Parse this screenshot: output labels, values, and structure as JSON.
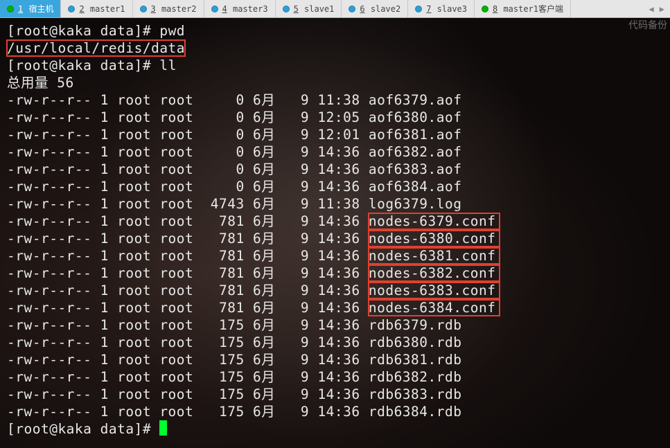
{
  "tabs": [
    {
      "dot": "green",
      "num": "1",
      "label": "宿主机",
      "active": true
    },
    {
      "dot": "blue",
      "num": "2",
      "label": "master1"
    },
    {
      "dot": "blue",
      "num": "3",
      "label": "master2"
    },
    {
      "dot": "blue",
      "num": "4",
      "label": "master3"
    },
    {
      "dot": "blue",
      "num": "5",
      "label": "slave1"
    },
    {
      "dot": "blue",
      "num": "6",
      "label": "slave2"
    },
    {
      "dot": "blue",
      "num": "7",
      "label": "slave3"
    },
    {
      "dot": "green",
      "num": "8",
      "label": "master1客户端"
    }
  ],
  "watermark": "代码备份",
  "prompt": {
    "user": "root",
    "host": "kaka",
    "cwd": "data",
    "symbol": "#"
  },
  "cmds": {
    "pwd": "pwd",
    "ll": "ll"
  },
  "cwd_path": "/usr/local/redis/data",
  "total_label": "总用量",
  "total_value": "56",
  "ls": [
    {
      "perm": "-rw-r--r--",
      "l": "1",
      "u": "root",
      "g": "root",
      "size": "0",
      "mon": "6月",
      "day": "9",
      "time": "11:38",
      "name": "aof6379.aof",
      "hl": false
    },
    {
      "perm": "-rw-r--r--",
      "l": "1",
      "u": "root",
      "g": "root",
      "size": "0",
      "mon": "6月",
      "day": "9",
      "time": "12:05",
      "name": "aof6380.aof",
      "hl": false
    },
    {
      "perm": "-rw-r--r--",
      "l": "1",
      "u": "root",
      "g": "root",
      "size": "0",
      "mon": "6月",
      "day": "9",
      "time": "12:01",
      "name": "aof6381.aof",
      "hl": false
    },
    {
      "perm": "-rw-r--r--",
      "l": "1",
      "u": "root",
      "g": "root",
      "size": "0",
      "mon": "6月",
      "day": "9",
      "time": "14:36",
      "name": "aof6382.aof",
      "hl": false
    },
    {
      "perm": "-rw-r--r--",
      "l": "1",
      "u": "root",
      "g": "root",
      "size": "0",
      "mon": "6月",
      "day": "9",
      "time": "14:36",
      "name": "aof6383.aof",
      "hl": false
    },
    {
      "perm": "-rw-r--r--",
      "l": "1",
      "u": "root",
      "g": "root",
      "size": "0",
      "mon": "6月",
      "day": "9",
      "time": "14:36",
      "name": "aof6384.aof",
      "hl": false
    },
    {
      "perm": "-rw-r--r--",
      "l": "1",
      "u": "root",
      "g": "root",
      "size": "4743",
      "mon": "6月",
      "day": "9",
      "time": "11:38",
      "name": "log6379.log",
      "hl": false
    },
    {
      "perm": "-rw-r--r--",
      "l": "1",
      "u": "root",
      "g": "root",
      "size": "781",
      "mon": "6月",
      "day": "9",
      "time": "14:36",
      "name": "nodes-6379.conf",
      "hl": true
    },
    {
      "perm": "-rw-r--r--",
      "l": "1",
      "u": "root",
      "g": "root",
      "size": "781",
      "mon": "6月",
      "day": "9",
      "time": "14:36",
      "name": "nodes-6380.conf",
      "hl": true
    },
    {
      "perm": "-rw-r--r--",
      "l": "1",
      "u": "root",
      "g": "root",
      "size": "781",
      "mon": "6月",
      "day": "9",
      "time": "14:36",
      "name": "nodes-6381.conf",
      "hl": true
    },
    {
      "perm": "-rw-r--r--",
      "l": "1",
      "u": "root",
      "g": "root",
      "size": "781",
      "mon": "6月",
      "day": "9",
      "time": "14:36",
      "name": "nodes-6382.conf",
      "hl": true
    },
    {
      "perm": "-rw-r--r--",
      "l": "1",
      "u": "root",
      "g": "root",
      "size": "781",
      "mon": "6月",
      "day": "9",
      "time": "14:36",
      "name": "nodes-6383.conf",
      "hl": true
    },
    {
      "perm": "-rw-r--r--",
      "l": "1",
      "u": "root",
      "g": "root",
      "size": "781",
      "mon": "6月",
      "day": "9",
      "time": "14:36",
      "name": "nodes-6384.conf",
      "hl": true
    },
    {
      "perm": "-rw-r--r--",
      "l": "1",
      "u": "root",
      "g": "root",
      "size": "175",
      "mon": "6月",
      "day": "9",
      "time": "14:36",
      "name": "rdb6379.rdb",
      "hl": false
    },
    {
      "perm": "-rw-r--r--",
      "l": "1",
      "u": "root",
      "g": "root",
      "size": "175",
      "mon": "6月",
      "day": "9",
      "time": "14:36",
      "name": "rdb6380.rdb",
      "hl": false
    },
    {
      "perm": "-rw-r--r--",
      "l": "1",
      "u": "root",
      "g": "root",
      "size": "175",
      "mon": "6月",
      "day": "9",
      "time": "14:36",
      "name": "rdb6381.rdb",
      "hl": false
    },
    {
      "perm": "-rw-r--r--",
      "l": "1",
      "u": "root",
      "g": "root",
      "size": "175",
      "mon": "6月",
      "day": "9",
      "time": "14:36",
      "name": "rdb6382.rdb",
      "hl": false
    },
    {
      "perm": "-rw-r--r--",
      "l": "1",
      "u": "root",
      "g": "root",
      "size": "175",
      "mon": "6月",
      "day": "9",
      "time": "14:36",
      "name": "rdb6383.rdb",
      "hl": false
    },
    {
      "perm": "-rw-r--r--",
      "l": "1",
      "u": "root",
      "g": "root",
      "size": "175",
      "mon": "6月",
      "day": "9",
      "time": "14:36",
      "name": "rdb6384.rdb",
      "hl": false
    }
  ]
}
